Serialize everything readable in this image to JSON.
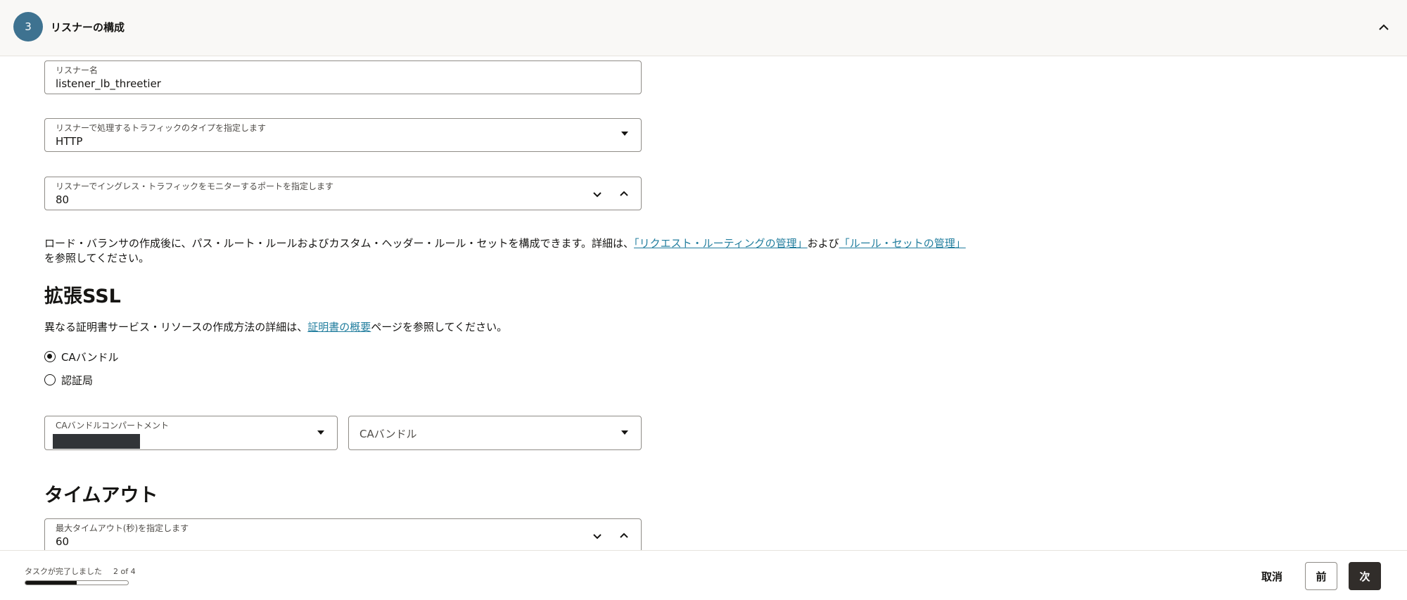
{
  "header": {
    "step_number": "3",
    "title": "リスナーの構成"
  },
  "listener_name": {
    "label": "リスナー名",
    "value": "listener_lb_threetier"
  },
  "traffic_type": {
    "label": "リスナーで処理するトラフィックのタイプを指定します",
    "value": "HTTP"
  },
  "port": {
    "label": "リスナーでイングレス・トラフィックをモニターするポートを指定します",
    "value": "80"
  },
  "routing_info": {
    "text_before": "ロード・バランサの作成後に、パス・ルート・ルールおよびカスタム・ヘッダー・ルール・セットを構成できます。詳細は、",
    "link1": "「リクエスト・ルーティングの管理」",
    "text_mid": "および",
    "link2": "「ルール・セットの管理」",
    "text_after": "を参照してください。"
  },
  "ssl": {
    "heading": "拡張SSL",
    "help_before": "異なる証明書サービス・リソースの作成方法の詳細は、",
    "help_link": "証明書の概要",
    "help_after": "ページを参照してください。",
    "options": [
      {
        "label": "CAバンドル",
        "checked": true
      },
      {
        "label": "認証局",
        "checked": false
      }
    ],
    "compartment_label": "CAバンドルコンパートメント",
    "bundle_placeholder": "CAバンドル"
  },
  "timeout": {
    "heading": "タイムアウト",
    "label": "最大タイムアウト(秒)を指定します",
    "value": "60"
  },
  "footer": {
    "status": "タスクが完了しました",
    "progress": "2 of 4",
    "progress_fraction": 0.5,
    "cancel": "取消",
    "back": "前",
    "next": "次"
  }
}
